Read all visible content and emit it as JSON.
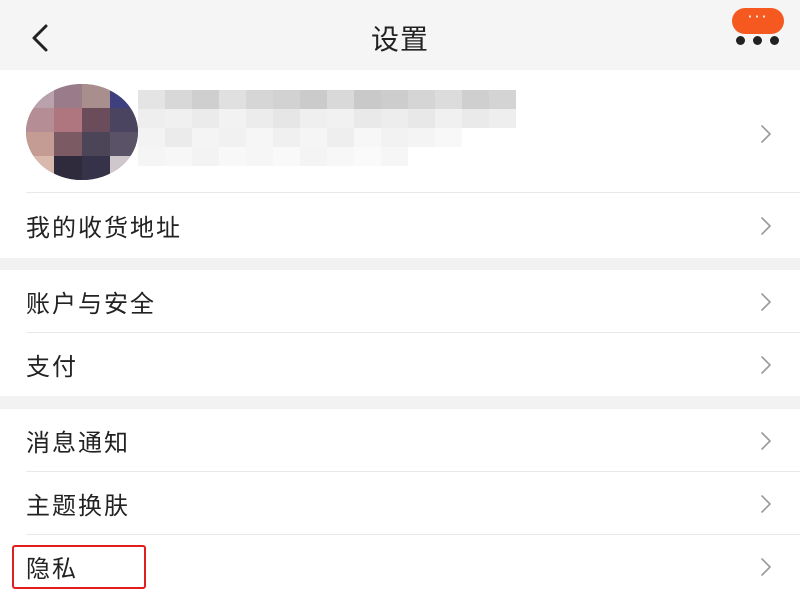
{
  "header": {
    "title": "设置",
    "more_label": "···"
  },
  "profile": {
    "name": "",
    "avatar_alt": ""
  },
  "groups": [
    {
      "items": [
        {
          "label": "我的收货地址"
        }
      ]
    },
    {
      "items": [
        {
          "label": "账户与安全"
        },
        {
          "label": "支付"
        }
      ]
    },
    {
      "items": [
        {
          "label": "消息通知"
        },
        {
          "label": "主题换肤"
        },
        {
          "label": "隐私"
        }
      ]
    }
  ],
  "colors": {
    "accent": "#f5591f",
    "highlight": "#e21d1d",
    "background": "#f2f2f2"
  },
  "icons": {
    "back": "chevron-left-icon",
    "more": "more-icon",
    "row_arrow": "chevron-right-icon"
  }
}
